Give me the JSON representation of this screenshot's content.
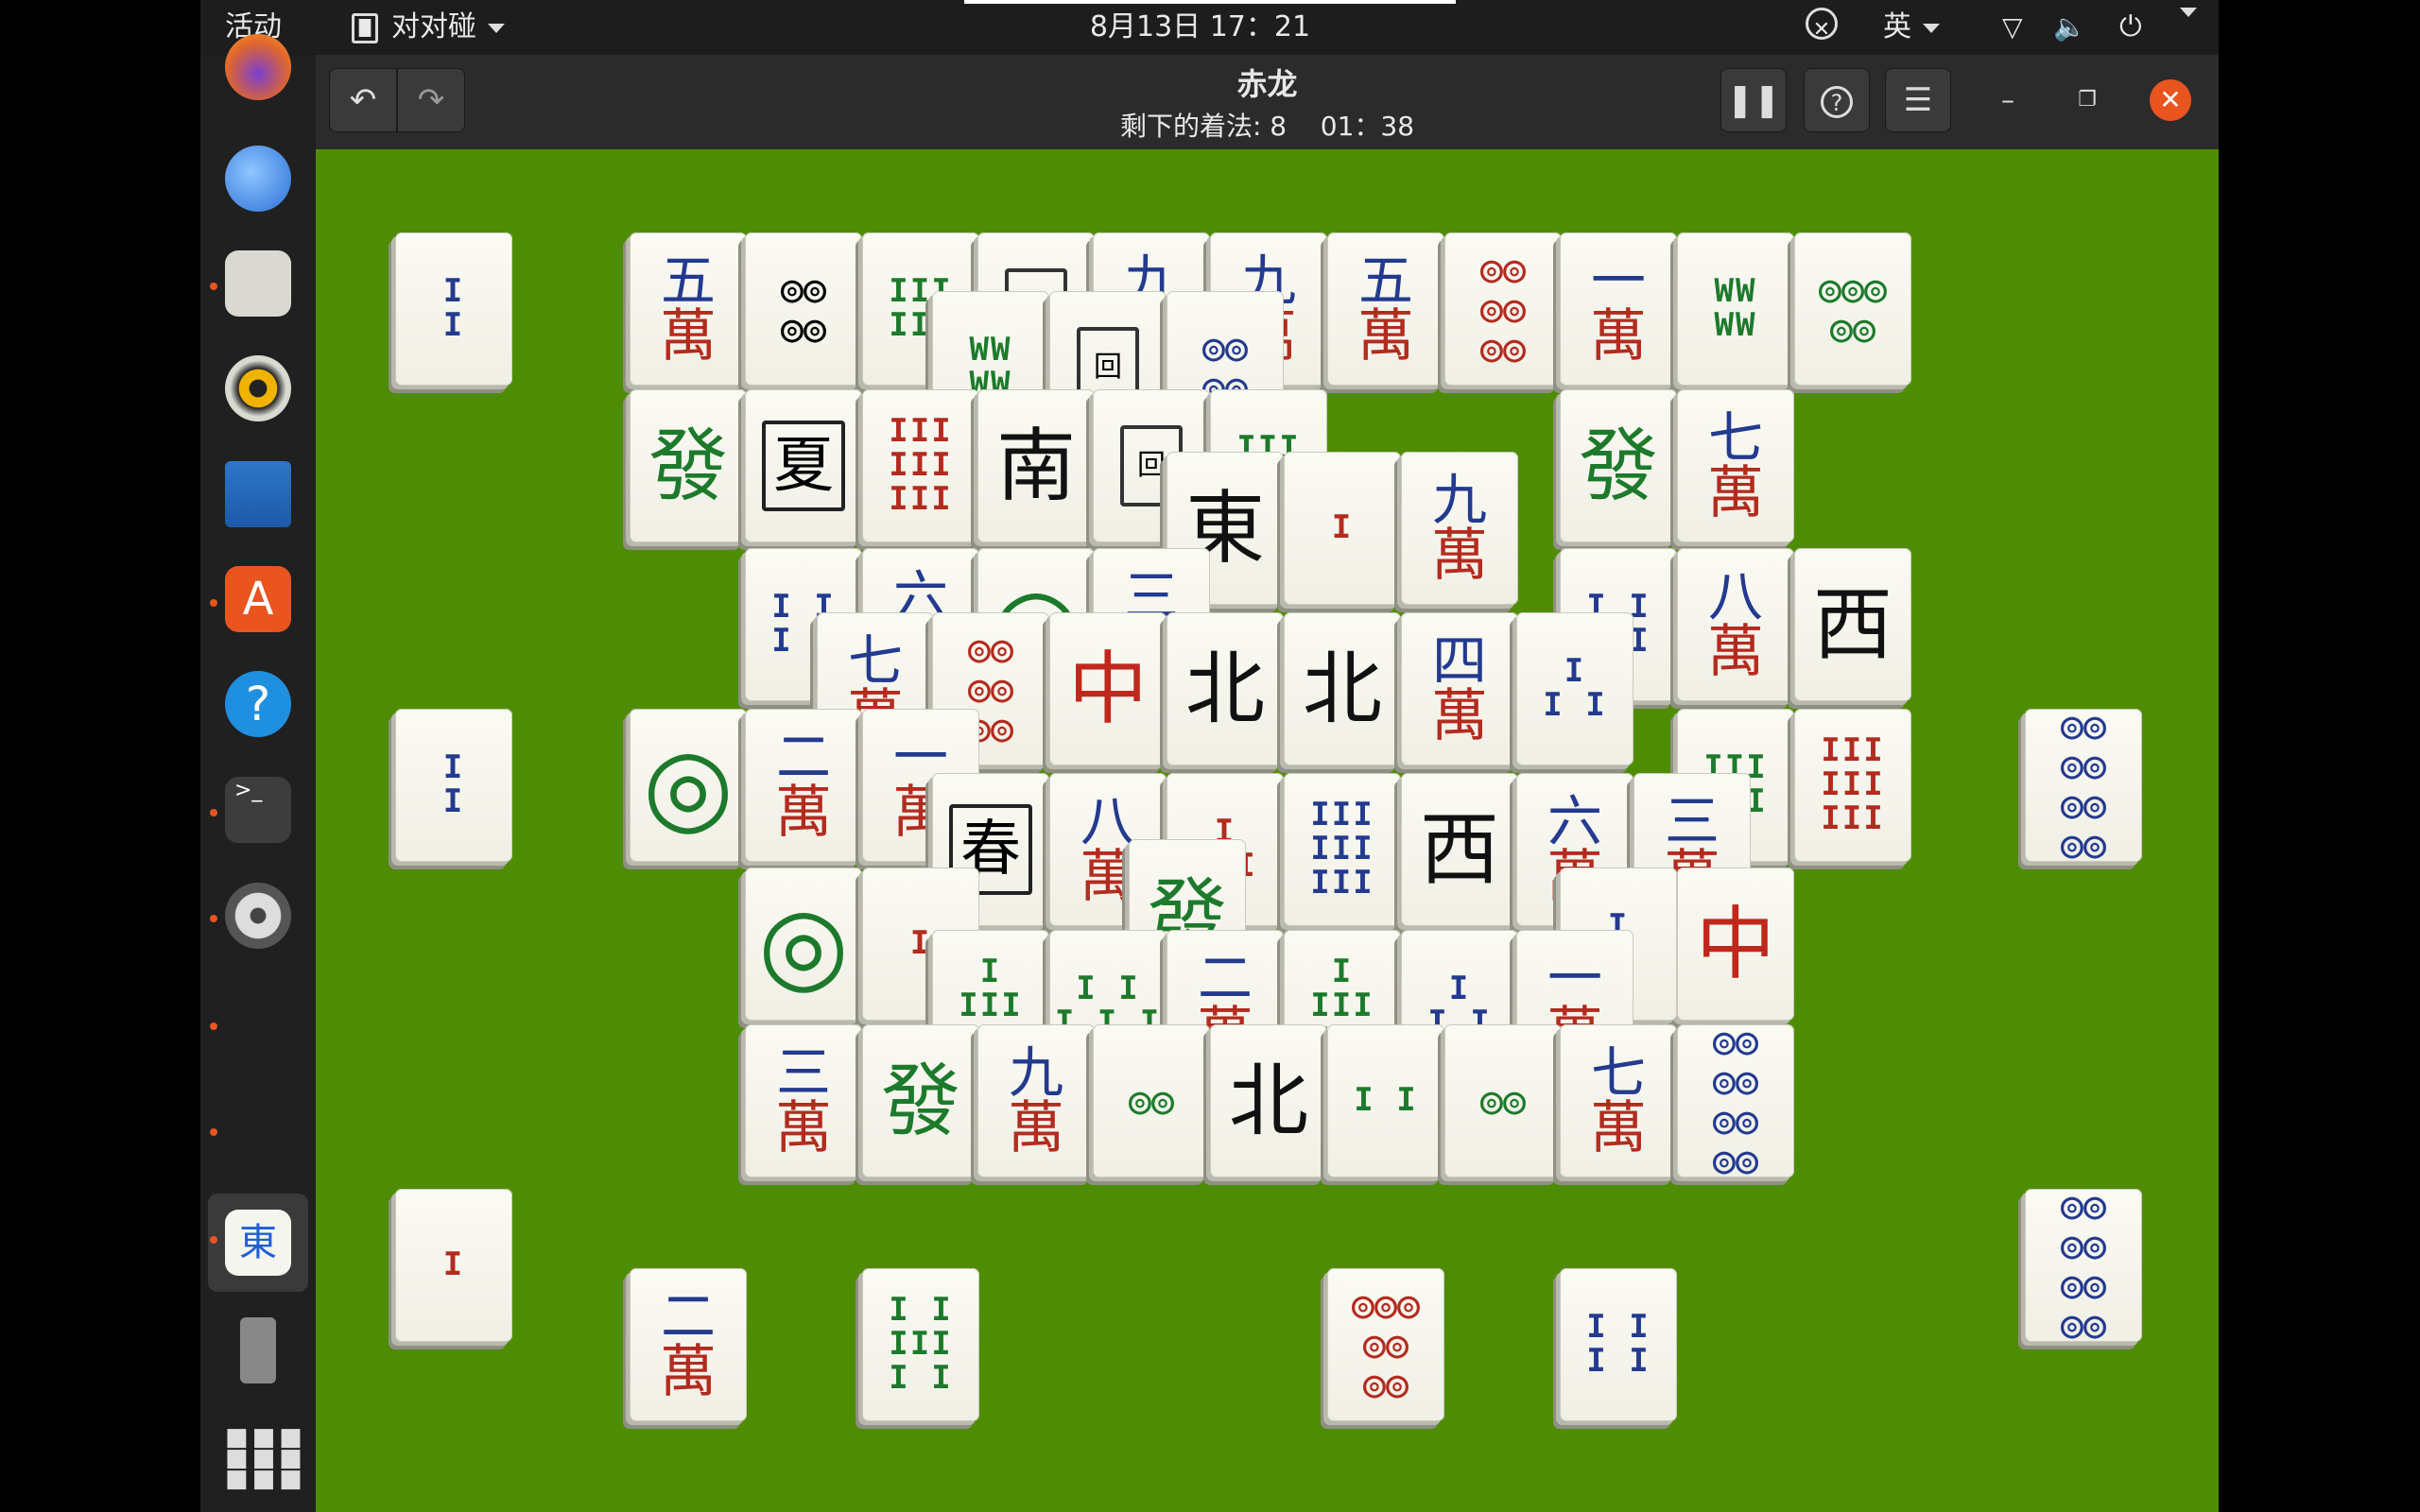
{
  "topbar": {
    "activities": "活动",
    "app_name": "对对碰",
    "clock": "8月13日 17：21",
    "lang": "英",
    "tray_icons": [
      "accessibility-icon",
      "network-icon",
      "volume-icon",
      "power-icon"
    ]
  },
  "dock": {
    "items": [
      "firefox-icon",
      "thunderbird-icon",
      "files-icon",
      "rhythmbox-icon",
      "writer-icon",
      "software-icon",
      "help-icon",
      "terminal-icon",
      "settings-icon",
      "mahjongg-icon",
      "usb-drive-icon",
      "show-apps-icon"
    ]
  },
  "header": {
    "title": "赤龙",
    "moves_label": "剩下的着法: 8",
    "time": "01：38",
    "undo_icon": "undo-icon",
    "redo_icon": "redo-icon",
    "pause_icon": "pause-icon",
    "help_icon": "help-icon",
    "menu_icon": "hamburger-menu-icon"
  },
  "colors": {
    "board_green": "#4e8d03",
    "close_orange": "#e9541f",
    "topbar_bg": "#1d1d1d",
    "header_bg": "#2b2b2b"
  },
  "tiles": [
    {
      "kind": "bam",
      "text": "I\nI",
      "cls": "c-blue"
    },
    {
      "kind": "num",
      "n": "五",
      "w": "萬"
    },
    {
      "kind": "dot",
      "text": "◎◎\n◎◎"
    },
    {
      "kind": "bam",
      "text": "III\nIII",
      "cls": "c-green"
    },
    {
      "kind": "white",
      "text": "回"
    },
    {
      "kind": "num",
      "n": "九",
      "w": "萬"
    },
    {
      "kind": "num",
      "n": "九",
      "w": "萬"
    },
    {
      "kind": "num",
      "n": "五",
      "w": "萬"
    },
    {
      "kind": "dot",
      "text": "◎◎\n◎◎\n◎◎",
      "cls": "c-red"
    },
    {
      "kind": "num",
      "n": "一",
      "w": "萬"
    },
    {
      "kind": "bam",
      "text": "WW\nWW",
      "cls": "c-green"
    },
    {
      "kind": "dot",
      "text": "◎◎◎\n◎◎",
      "cls": "c-green"
    },
    {
      "kind": "green",
      "text": "發"
    },
    {
      "kind": "flower",
      "text": "夏"
    },
    {
      "kind": "bam",
      "text": "III\nIII\nIII",
      "cls": "c-red"
    },
    {
      "kind": "wind",
      "text": "南"
    },
    {
      "kind": "white",
      "text": "回"
    },
    {
      "kind": "bam",
      "text": "III\nIII",
      "cls": "c-green"
    },
    {
      "kind": "green",
      "text": "發"
    },
    {
      "kind": "num",
      "n": "七",
      "w": "萬"
    },
    {
      "kind": "bam",
      "text": "WW\nWW",
      "cls": "c-green"
    },
    {
      "kind": "white",
      "text": "回"
    },
    {
      "kind": "dot",
      "text": "◎◎\n◎◎",
      "cls": "c-blue"
    },
    {
      "kind": "bam",
      "text": "I I\nI I",
      "cls": "c-blue"
    },
    {
      "kind": "num",
      "n": "六",
      "w": "萬"
    },
    {
      "kind": "onedot",
      "text": "◎"
    },
    {
      "kind": "num",
      "n": "三",
      "w": "萬"
    },
    {
      "kind": "bam",
      "text": "I I\nI I",
      "cls": "c-blue"
    },
    {
      "kind": "num",
      "n": "八",
      "w": "萬"
    },
    {
      "kind": "wind",
      "text": "西"
    },
    {
      "kind": "wind",
      "text": "東"
    },
    {
      "kind": "bam",
      "text": "I",
      "cls": "c-red"
    },
    {
      "kind": "num",
      "n": "九",
      "w": "萬"
    },
    {
      "kind": "num",
      "n": "七",
      "w": "萬"
    },
    {
      "kind": "dot",
      "text": "◎◎\n◎◎\n◎◎",
      "cls": "c-red"
    },
    {
      "kind": "red",
      "text": "中"
    },
    {
      "kind": "wind",
      "text": "北"
    },
    {
      "kind": "wind",
      "text": "北"
    },
    {
      "kind": "num",
      "n": "四",
      "w": "萬"
    },
    {
      "kind": "bam",
      "text": "I\nI I",
      "cls": "c-blue"
    },
    {
      "kind": "bam",
      "text": "I\nI",
      "cls": "c-blue"
    },
    {
      "kind": "onedot",
      "text": "◎"
    },
    {
      "kind": "num",
      "n": "二",
      "w": "萬"
    },
    {
      "kind": "num",
      "n": "一",
      "w": "萬"
    },
    {
      "kind": "bam",
      "text": "III\nIII",
      "cls": "c-green"
    },
    {
      "kind": "bam",
      "text": "III\nIII\nIII",
      "cls": "c-red"
    },
    {
      "kind": "dot",
      "text": "◎◎\n◎◎\n◎◎\n◎◎",
      "cls": "c-blue"
    },
    {
      "kind": "flower",
      "text": "春"
    },
    {
      "kind": "num",
      "n": "八",
      "w": "萬"
    },
    {
      "kind": "bam",
      "text": "I\nIII",
      "cls": "c-red"
    },
    {
      "kind": "bam",
      "text": "III\nIII\nIII",
      "cls": "c-blue"
    },
    {
      "kind": "wind",
      "text": "西"
    },
    {
      "kind": "num",
      "n": "六",
      "w": "萬"
    },
    {
      "kind": "num",
      "n": "三",
      "w": "萬"
    },
    {
      "kind": "green",
      "text": "發"
    },
    {
      "kind": "onedot",
      "text": "◎"
    },
    {
      "kind": "bam",
      "text": "I",
      "cls": "c-red"
    },
    {
      "kind": "red",
      "text": "中"
    },
    {
      "kind": "bam",
      "text": "I\nIII\nIII",
      "cls": "c-green"
    },
    {
      "kind": "bam",
      "text": "I I\nI I I",
      "cls": "c-green"
    },
    {
      "kind": "num",
      "n": "二",
      "w": "萬"
    },
    {
      "kind": "bam",
      "text": "I\nIII\nIII",
      "cls": "c-green"
    },
    {
      "kind": "bam",
      "text": "I\nI I",
      "cls": "c-blue"
    },
    {
      "kind": "num",
      "n": "一",
      "w": "萬"
    },
    {
      "kind": "bam",
      "text": "I\nI",
      "cls": "c-blue"
    },
    {
      "kind": "num",
      "n": "三",
      "w": "萬"
    },
    {
      "kind": "green",
      "text": "發"
    },
    {
      "kind": "num",
      "n": "九",
      "w": "萬"
    },
    {
      "kind": "dot",
      "text": "◎◎",
      "cls": "c-green"
    },
    {
      "kind": "wind",
      "text": "北"
    },
    {
      "kind": "bam",
      "text": "I I",
      "cls": "c-green"
    },
    {
      "kind": "dot",
      "text": "◎◎",
      "cls": "c-green"
    },
    {
      "kind": "num",
      "n": "七",
      "w": "萬"
    },
    {
      "kind": "dot",
      "text": "◎◎\n◎◎\n◎◎\n◎◎",
      "cls": "c-blue"
    },
    {
      "kind": "dot",
      "text": "◎◎\n◎◎\n◎◎\n◎◎",
      "cls": "c-blue"
    },
    {
      "kind": "bam",
      "text": "I",
      "cls": "c-red"
    },
    {
      "kind": "num",
      "n": "二",
      "w": "萬"
    },
    {
      "kind": "bam",
      "text": "I I\nIII\nI I",
      "cls": "c-green"
    },
    {
      "kind": "dot",
      "text": "◎◎◎\n◎◎\n◎◎",
      "cls": "c-red"
    },
    {
      "kind": "bam",
      "text": "I I\nI I",
      "cls": "c-blue"
    }
  ]
}
